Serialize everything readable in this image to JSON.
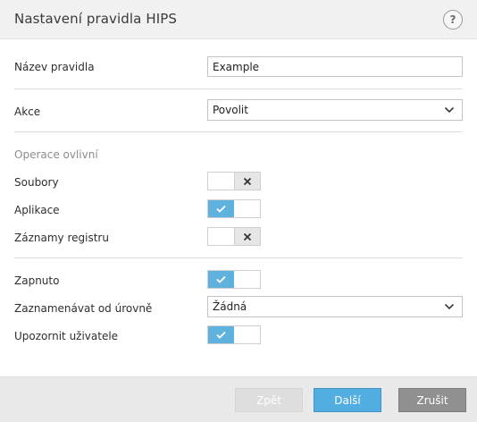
{
  "window": {
    "title": "Nastavení pravidla HIPS",
    "help_label": "?"
  },
  "form": {
    "rule_name_label": "Název pravidla",
    "rule_name_value": "Example",
    "action_label": "Akce",
    "action_value": "Povolit",
    "operations_heading": "Operace ovlivní",
    "files_label": "Soubory",
    "files_enabled": false,
    "applications_label": "Aplikace",
    "applications_enabled": true,
    "registry_label": "Záznamy registru",
    "registry_enabled": false,
    "enabled_label": "Zapnuto",
    "enabled_state": true,
    "log_level_label": "Zaznamenávat od úrovně",
    "log_level_value": "Žádná",
    "notify_label": "Upozornit uživatele",
    "notify_enabled": true
  },
  "footer": {
    "back_label": "Zpět",
    "next_label": "Další",
    "cancel_label": "Zrušit"
  },
  "colors": {
    "toggle_on": "#5fb2dd",
    "primary_button": "#52ade0",
    "cancel_button": "#909090",
    "disabled_button": "#dedede"
  },
  "icons": [
    "help-icon",
    "chevron-down-icon",
    "check-icon",
    "x-icon"
  ]
}
